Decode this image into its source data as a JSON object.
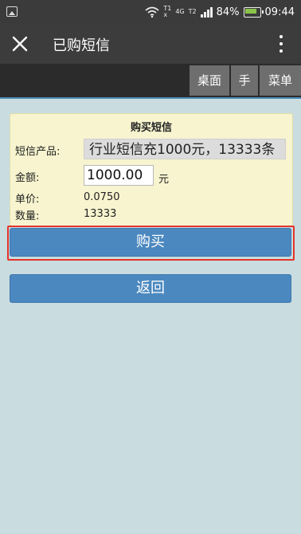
{
  "status_bar": {
    "network_top": "T1",
    "network_bottom": "x",
    "network_type": "4G",
    "signal_label": "T2",
    "battery": "84%",
    "time": "09:44"
  },
  "app_bar": {
    "title": "已购短信"
  },
  "nav": {
    "desktop": "桌面",
    "hand": "手",
    "menu": "菜单"
  },
  "form": {
    "title": "购买短信",
    "product_label": "短信产品:",
    "product_value": "行业短信充1000元，13333条",
    "amount_label": "金额:",
    "amount_value": "1000.00",
    "amount_unit": "元",
    "unit_price_label": "单价:",
    "unit_price_value": "0.0750",
    "quantity_label": "数量:",
    "quantity_value": "13333"
  },
  "actions": {
    "buy": "购买",
    "back": "返回"
  },
  "colors": {
    "background": "#c9dce0",
    "panel": "#f7f4cf",
    "button": "#4b88bf",
    "highlight": "#e4342c"
  }
}
